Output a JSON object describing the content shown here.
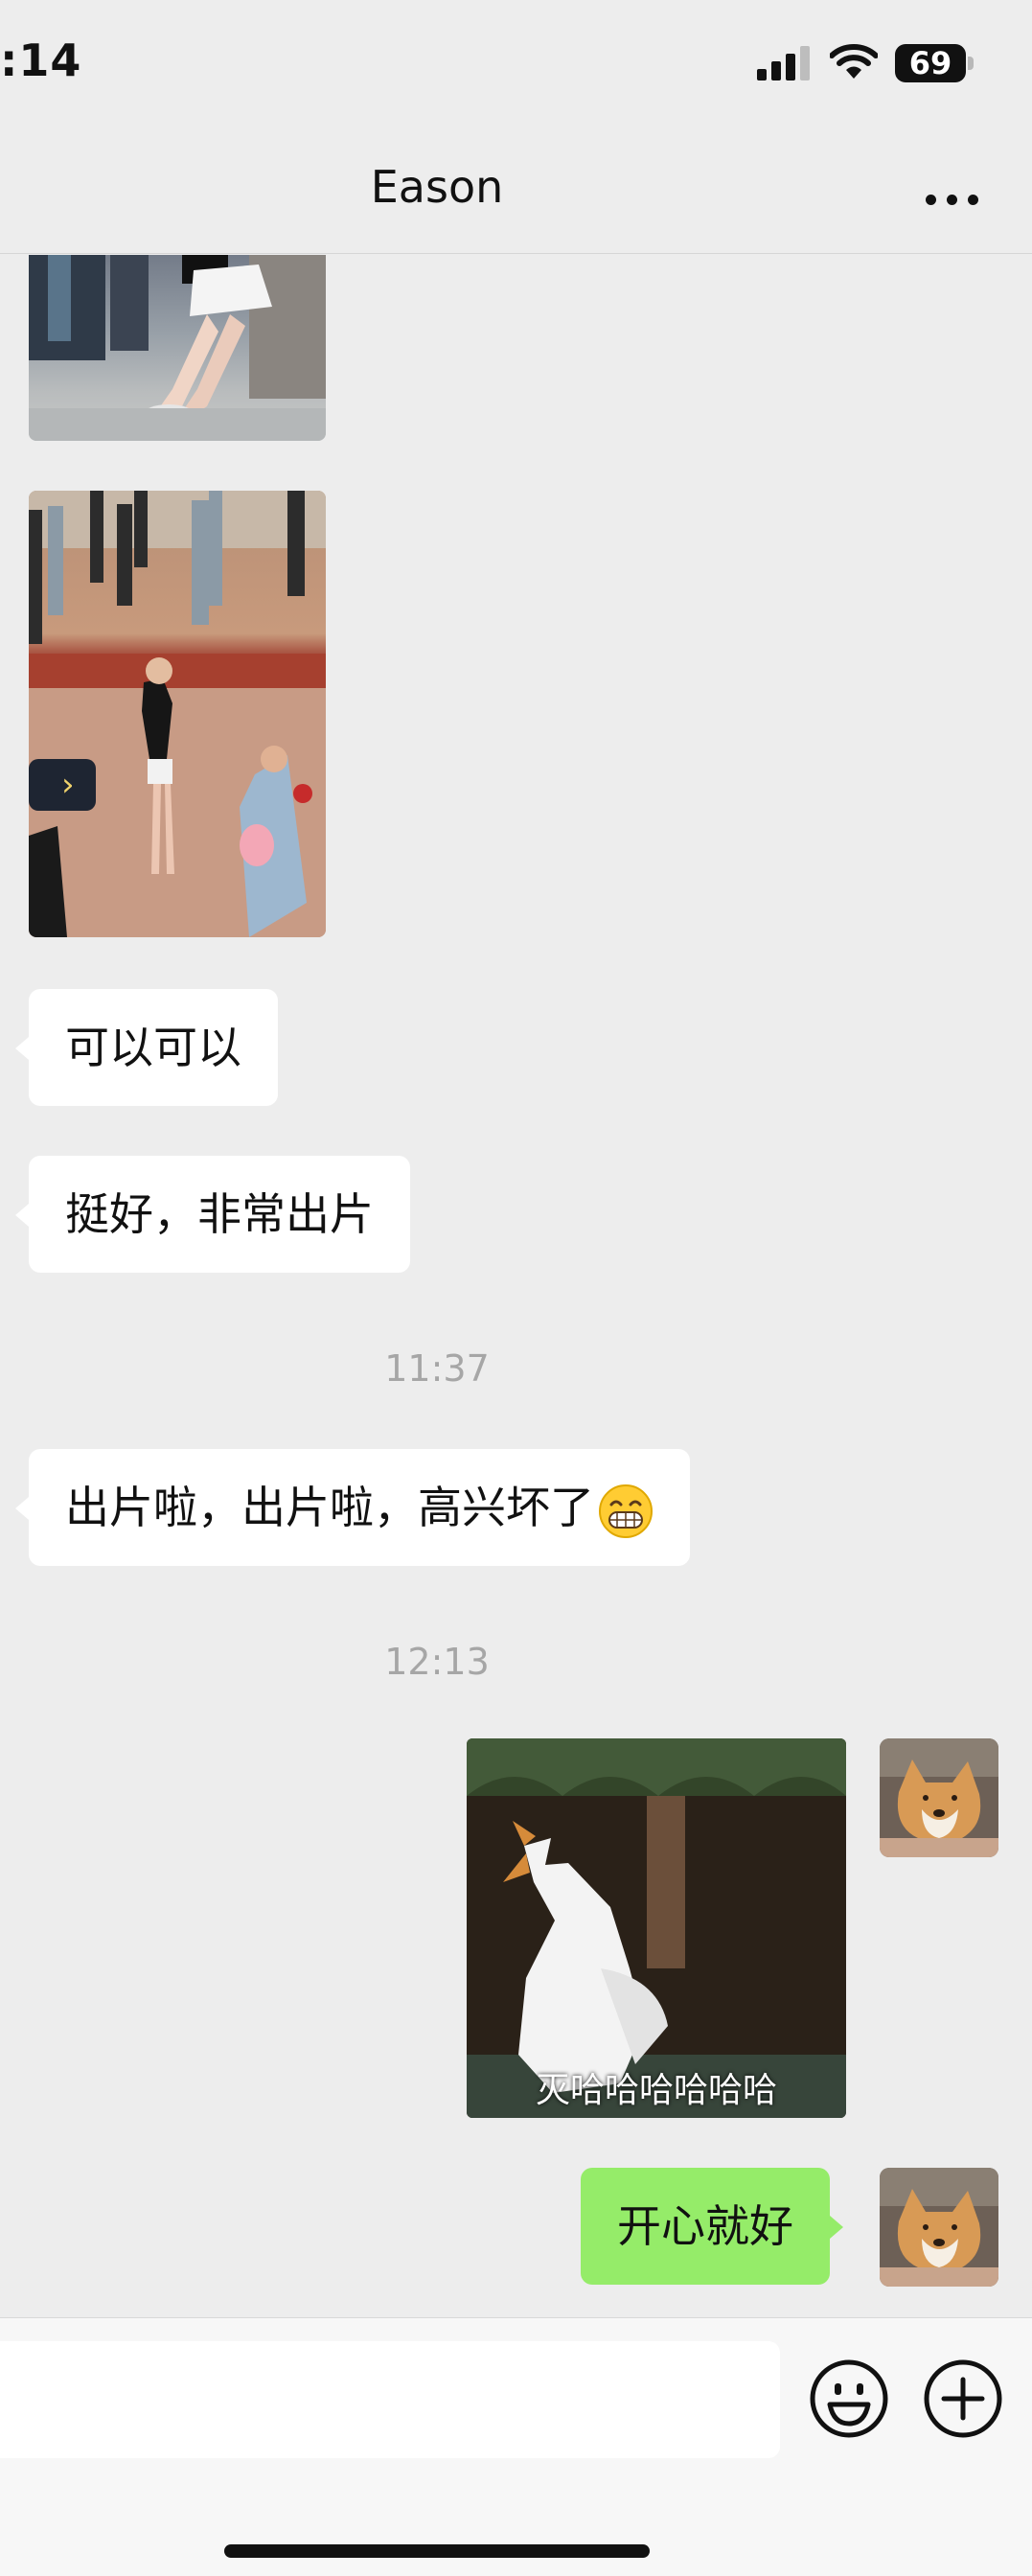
{
  "status_bar": {
    "time": ":14",
    "battery": "69"
  },
  "header": {
    "title": "Eason"
  },
  "messages": {
    "m1": "可以可以",
    "m2": "挺好，非常出片",
    "m3": "出片啦，出片啦，高兴坏了",
    "m4": "开心就好"
  },
  "timestamps": {
    "t1": "11:37",
    "t2": "12:13"
  },
  "sticker": {
    "caption": "灭哈哈哈哈哈哈"
  },
  "input": {
    "value": ""
  },
  "icons": {
    "more": "more-icon",
    "emoji": "grinning-face-icon",
    "smiley_button": "smiley-icon",
    "add_button": "plus-circle-icon",
    "signal": "signal-icon",
    "wifi": "wifi-icon",
    "battery": "battery-icon"
  },
  "colors": {
    "bubble_self": "#95ec69",
    "bubble_other": "#ffffff",
    "background": "#ededed"
  }
}
